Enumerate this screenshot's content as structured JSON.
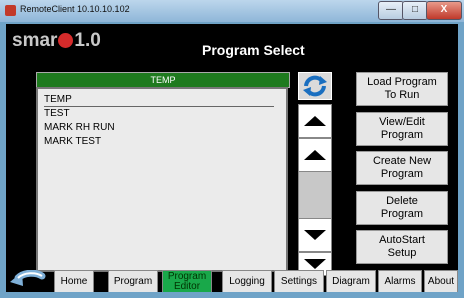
{
  "window": {
    "title": "RemoteClient 10.10.10.102",
    "min": "—",
    "max": "□",
    "close": "X"
  },
  "logo": {
    "text_left": "smar",
    "text_right": "1.0"
  },
  "page": {
    "title": "Program Select"
  },
  "list": {
    "header": "TEMP",
    "items": [
      "TEMP",
      "TEST",
      "MARK RH RUN",
      "MARK TEST"
    ]
  },
  "actions": [
    "Load Program\nTo Run",
    "View/Edit\nProgram",
    "Create New\nProgram",
    "Delete\nProgram",
    "AutoStart\nSetup"
  ],
  "tabs": [
    "Home",
    "Program",
    "Program\nEditor",
    "Logging",
    "Settings",
    "Diagram",
    "Alarms",
    "About"
  ],
  "active_tab": 2,
  "colors": {
    "accent": "#1e7a1e",
    "active_tab": "#19a84a",
    "logo_red": "#d52b2b"
  }
}
